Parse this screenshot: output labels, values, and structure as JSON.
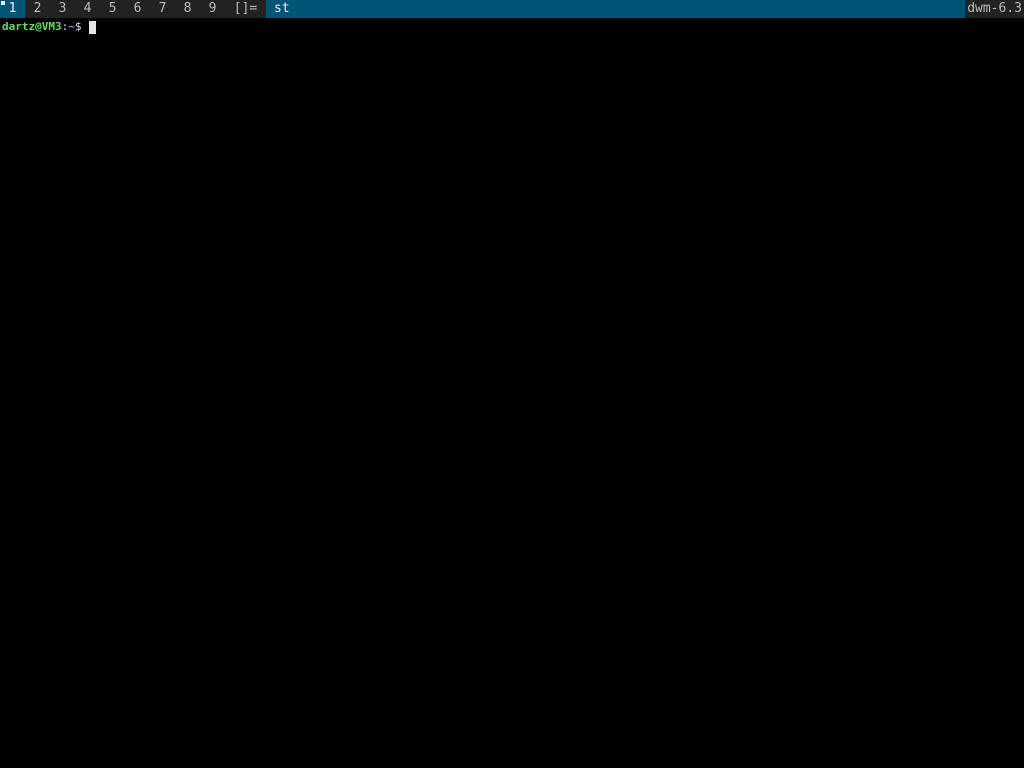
{
  "bar": {
    "tags": [
      {
        "label": "1",
        "selected": true,
        "occupied": true
      },
      {
        "label": "2",
        "selected": false,
        "occupied": false
      },
      {
        "label": "3",
        "selected": false,
        "occupied": false
      },
      {
        "label": "4",
        "selected": false,
        "occupied": false
      },
      {
        "label": "5",
        "selected": false,
        "occupied": false
      },
      {
        "label": "6",
        "selected": false,
        "occupied": false
      },
      {
        "label": "7",
        "selected": false,
        "occupied": false
      },
      {
        "label": "8",
        "selected": false,
        "occupied": false
      },
      {
        "label": "9",
        "selected": false,
        "occupied": false
      }
    ],
    "layout_symbol": "[]=",
    "window_title": "st",
    "status": "dwm-6.3"
  },
  "terminal": {
    "prompt_user_host": "dartz@VM3",
    "prompt_separator": ":",
    "prompt_path": "~",
    "prompt_symbol": "$ "
  },
  "colors": {
    "bar_bg": "#222222",
    "bar_fg": "#bbbbbb",
    "selected_bg": "#005577",
    "selected_fg": "#eeeeee",
    "terminal_bg": "#000000",
    "prompt_user": "#5ee05e",
    "prompt_path": "#5ea0ff"
  },
  "icons": {
    "occupied_indicator": "occupied-tag-indicator-icon",
    "cursor": "block-cursor-icon"
  }
}
